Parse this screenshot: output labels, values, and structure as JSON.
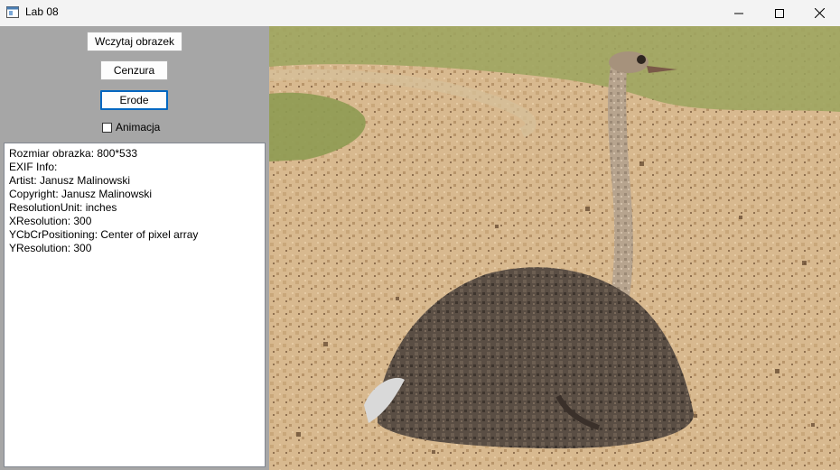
{
  "window": {
    "title": "Lab 08",
    "controls": [
      "minimize-icon",
      "maximize-icon",
      "close-icon"
    ]
  },
  "panel": {
    "load_button": "Wczytaj obrazek",
    "censor_button": "Cenzura",
    "erode_button": "Erode",
    "animation_checkbox": {
      "label": "Animacja",
      "checked": false
    },
    "info_lines": [
      "Rozmiar obrazka: 800*533",
      "EXIF Info:",
      "Artist: Janusz Malinowski",
      "Copyright: Janusz Malinowski",
      "ResolutionUnit: inches",
      "XResolution: 300",
      "YCbCrPositioning: Center of pixel array",
      "YResolution: 300"
    ]
  },
  "image": {
    "subject": "ostrich-sitting-on-sand-eroded-photo"
  },
  "colors": {
    "panel_bg": "#a6a6a6",
    "focus_accent": "#0067c0",
    "sand": "#d9b88d",
    "grass": "#8e9b52",
    "ostrich_body": "#5a4e44"
  }
}
